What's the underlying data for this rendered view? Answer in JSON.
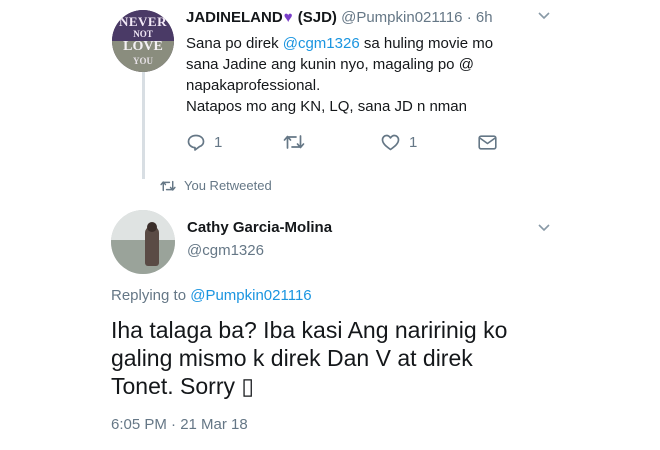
{
  "tweet1": {
    "avatar_text": [
      "NEVER",
      "NOT",
      "LOVE",
      "YOU"
    ],
    "display_name": "JADINELAND",
    "name_suffix": " (SJD)",
    "handle": "@Pumpkin021116",
    "separator": " · ",
    "time": "6h",
    "body": {
      "line1_pre": "Sana po direk ",
      "line1_mention": "@cgm1326",
      "line1_post": " sa huling movie mo",
      "line2": "sana Jadine ang kunin nyo, magaling po @",
      "line3": "napakaprofessional.",
      "line4": "Natapos mo ang KN, LQ, sana JD n nman"
    },
    "reply_count": "1",
    "like_count": "1"
  },
  "retweet_label": "You Retweeted",
  "tweet2": {
    "display_name": "Cathy Garcia-Molina",
    "handle": "@cgm1326",
    "replying_prefix": "Replying to ",
    "replying_handle": "@Pumpkin021116",
    "text_line1": "Iha talaga ba? Iba kasi Ang naririnig ko",
    "text_line2": "galing mismo k direk Dan V at direk",
    "text_line3": "Tonet. Sorry ▯",
    "timestamp": "6:05 PM · 21 Mar 18"
  },
  "colors": {
    "text": "#14171a",
    "secondary": "#657786",
    "link": "#1b95e0",
    "heart": "#7a3ec9",
    "thread_line": "#d8dee3"
  },
  "icons": [
    "purple-heart-icon",
    "chevron-down-icon",
    "reply-icon",
    "retweet-icon",
    "like-icon",
    "direct-message-icon"
  ]
}
